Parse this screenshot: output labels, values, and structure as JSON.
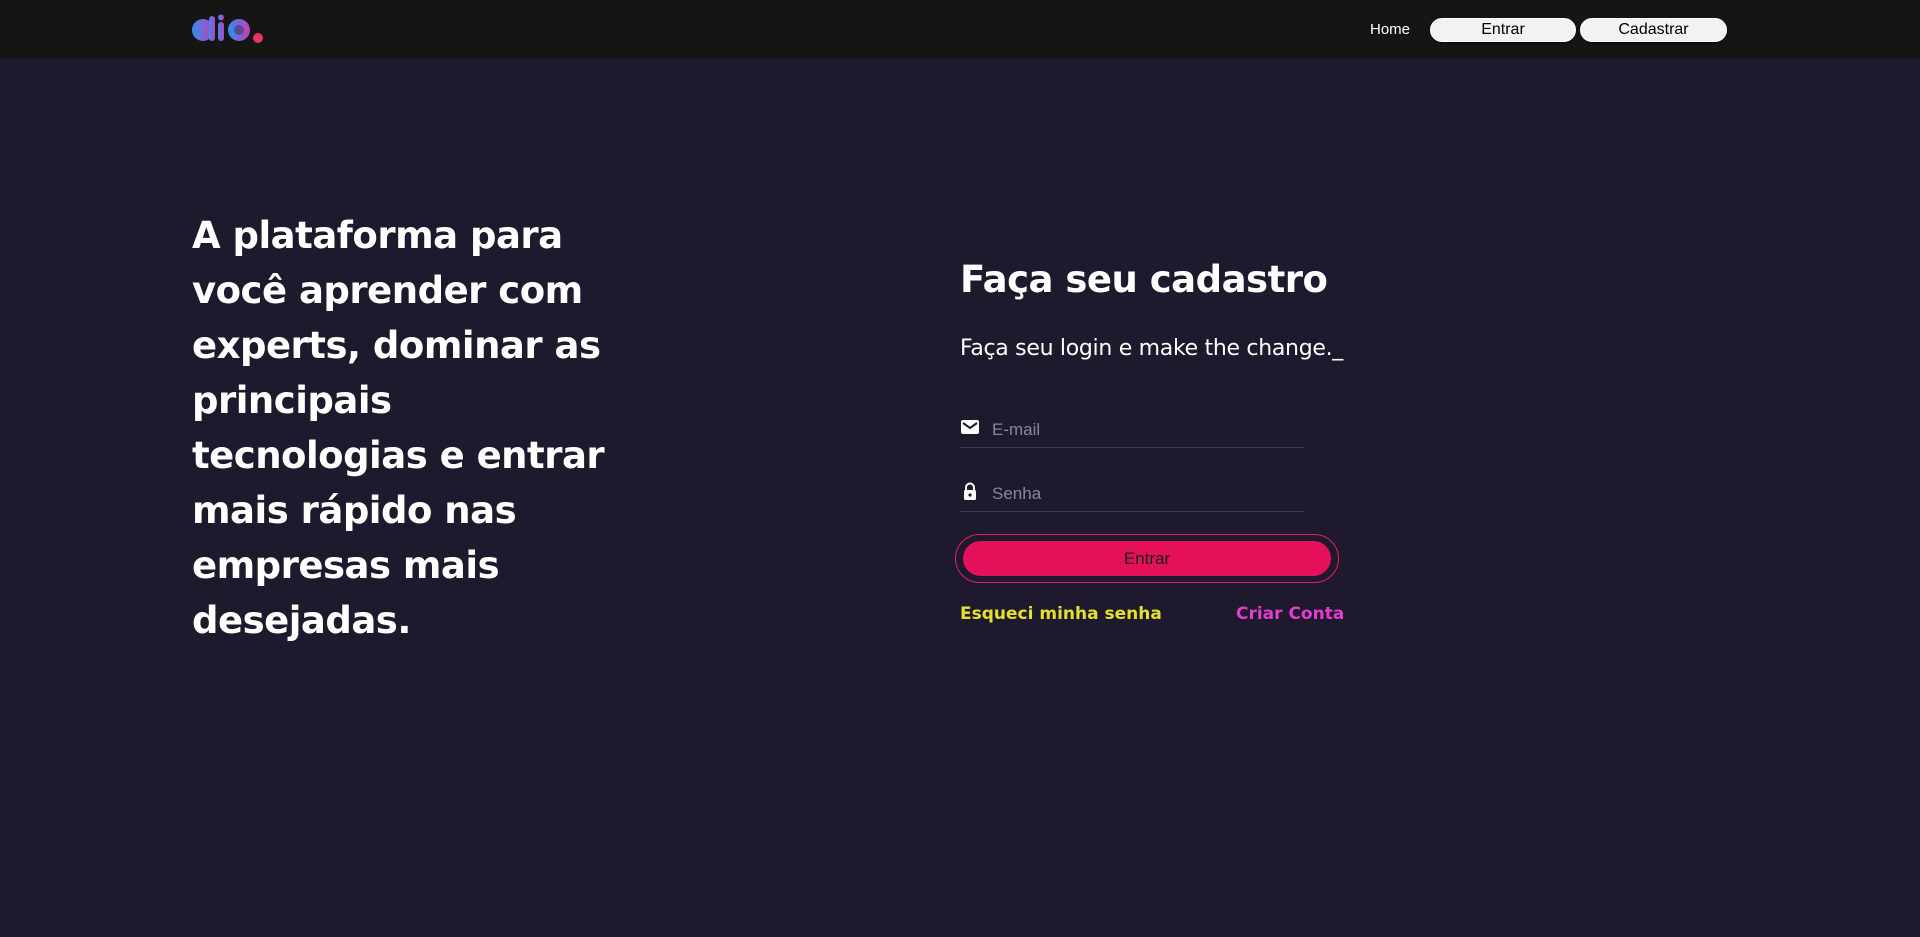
{
  "colors": {
    "page_background": "#1e192c",
    "topbar_background": "#151515",
    "accent": "#e41059",
    "forgot_link": "#e4e12e",
    "create_link": "#e23dcf",
    "logo_gradient_start": "#2f8ef3",
    "logo_gradient_end": "#c23fb8",
    "logo_dot": "#e8345f"
  },
  "header": {
    "logo_icon": "dio-logo-icon",
    "home_label": "Home",
    "entrar_label": "Entrar",
    "cadastrar_label": "Cadastrar"
  },
  "hero": {
    "text": "A plataforma para você aprender com experts, dominar as principais tecnologias e entrar mais rápido nas empresas mais desejadas."
  },
  "form": {
    "title": "Faça seu cadastro",
    "subtitle": "Faça seu login e make the change._",
    "email": {
      "icon": "mail-icon",
      "placeholder": "E-mail",
      "value": ""
    },
    "senha": {
      "icon": "lock-icon",
      "placeholder": "Senha",
      "value": ""
    },
    "submit_label": "Entrar",
    "forgot_label": "Esqueci minha senha",
    "create_label": "Criar Conta"
  }
}
